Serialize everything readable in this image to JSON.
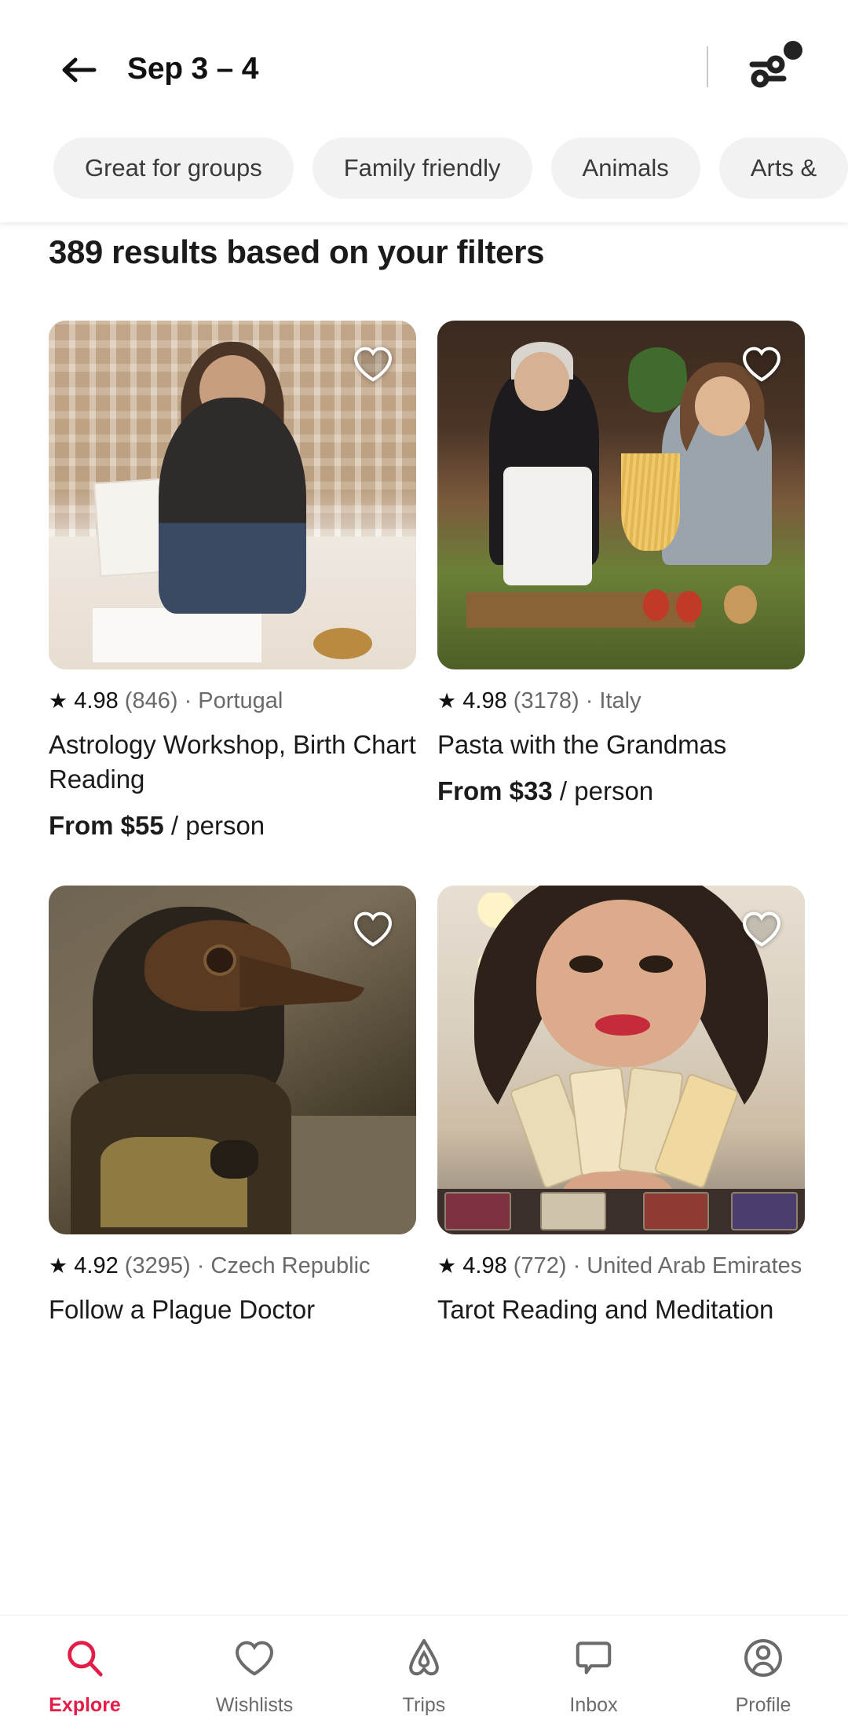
{
  "header": {
    "back_icon": "back-arrow-icon",
    "title": "Sep 3 – 4",
    "filter_icon": "tune-filter-icon",
    "filter_badge": "notification-dot",
    "chips": [
      {
        "label": "Great for groups"
      },
      {
        "label": "Family friendly"
      },
      {
        "label": "Animals"
      },
      {
        "label": "Arts &"
      }
    ]
  },
  "results": {
    "heading": "389 results based on your filters",
    "count": 389
  },
  "listings": [
    {
      "image_alt": "astrology-workshop-photo",
      "favorite_icon": "heart-outline-icon",
      "star_icon": "★",
      "rating": "4.98",
      "reviews": "(846)",
      "separator": "·",
      "location": "Portugal",
      "title": "Astrology Workshop, Birth Chart Reading",
      "price_prefix": "From $55",
      "price_suffix": "/ person"
    },
    {
      "image_alt": "pasta-with-grandmas-photo",
      "favorite_icon": "heart-outline-icon",
      "star_icon": "★",
      "rating": "4.98",
      "reviews": "(3178)",
      "separator": "·",
      "location": "Italy",
      "title": "Pasta with the Grandmas",
      "price_prefix": "From $33",
      "price_suffix": "/ person"
    },
    {
      "image_alt": "plague-doctor-photo",
      "favorite_icon": "heart-outline-icon",
      "star_icon": "★",
      "rating": "4.92",
      "reviews": "(3295)",
      "separator": "·",
      "location": "Czech Republic",
      "title": "Follow a Plague Doctor",
      "price_prefix": "",
      "price_suffix": ""
    },
    {
      "image_alt": "tarot-reading-photo",
      "favorite_icon": "heart-outline-icon",
      "star_icon": "★",
      "rating": "4.98",
      "reviews": "(772)",
      "separator": "·",
      "location": "United Arab Emirates",
      "title": "Tarot Reading and Meditation",
      "price_prefix": "",
      "price_suffix": ""
    }
  ],
  "bottom_nav": {
    "active_color": "#e11d48",
    "inactive_color": "#6b6b6b",
    "items": [
      {
        "label": "Explore",
        "icon": "search-icon",
        "active": true
      },
      {
        "label": "Wishlists",
        "icon": "heart-icon",
        "active": false
      },
      {
        "label": "Trips",
        "icon": "airbnb-bellhop-icon",
        "active": false
      },
      {
        "label": "Inbox",
        "icon": "chat-bubble-icon",
        "active": false
      },
      {
        "label": "Profile",
        "icon": "user-circle-icon",
        "active": false
      }
    ]
  }
}
